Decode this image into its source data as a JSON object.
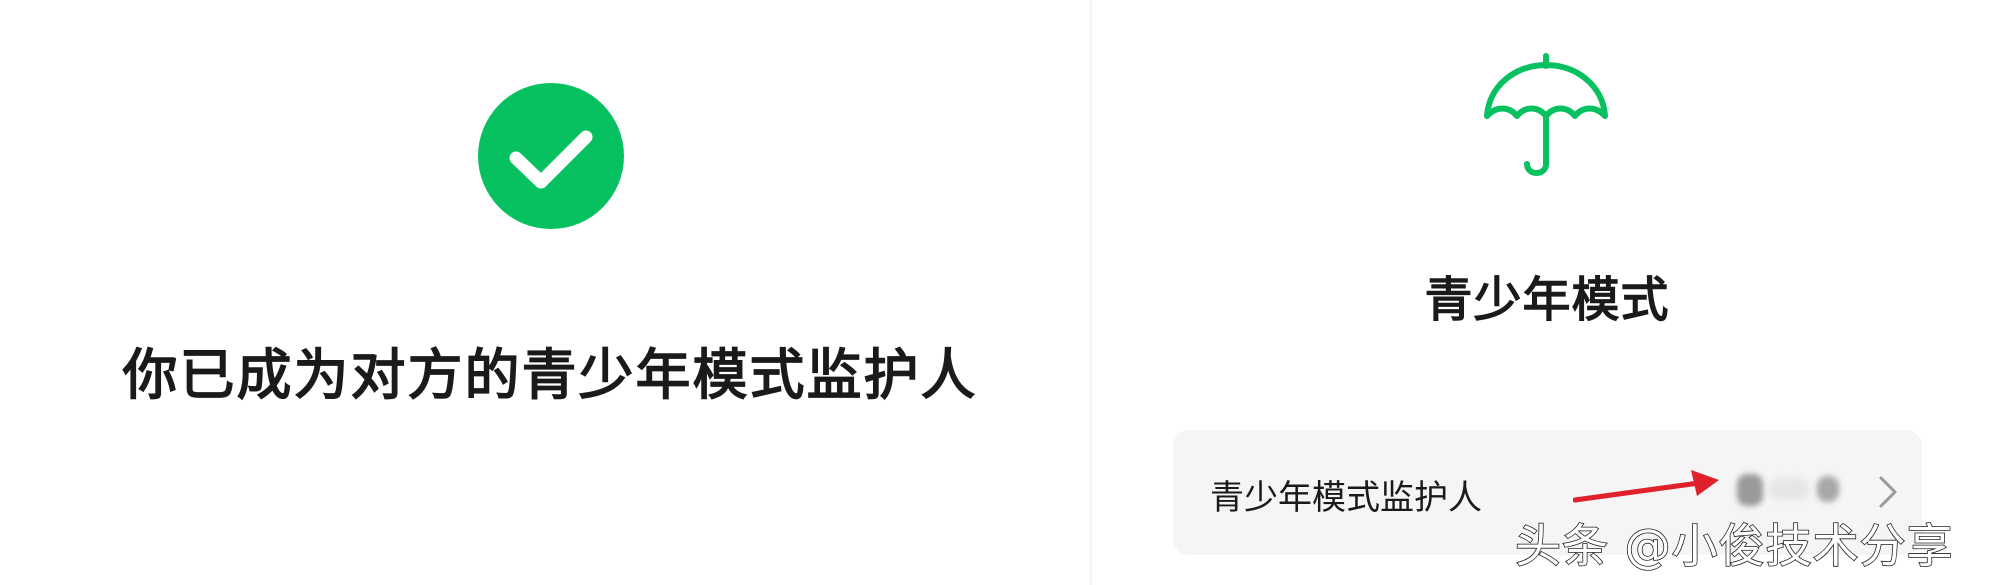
{
  "left_screen": {
    "success_icon": "check-circle-icon",
    "message": "你已成为对方的青少年模式监护人"
  },
  "right_screen": {
    "header_icon": "umbrella-icon",
    "title": "青少年模式",
    "guardian_row": {
      "label": "青少年模式监护人",
      "value_note": "obscured",
      "chevron_icon": "chevron-right-icon",
      "annotation_icon": "red-arrow-icon"
    }
  },
  "watermark": "头条 @小俊技术分享",
  "colors": {
    "accent_green": "#07C160",
    "annotation_red": "#E0202A",
    "row_background": "#F5F5F5",
    "text_primary": "#1A1A1A"
  }
}
